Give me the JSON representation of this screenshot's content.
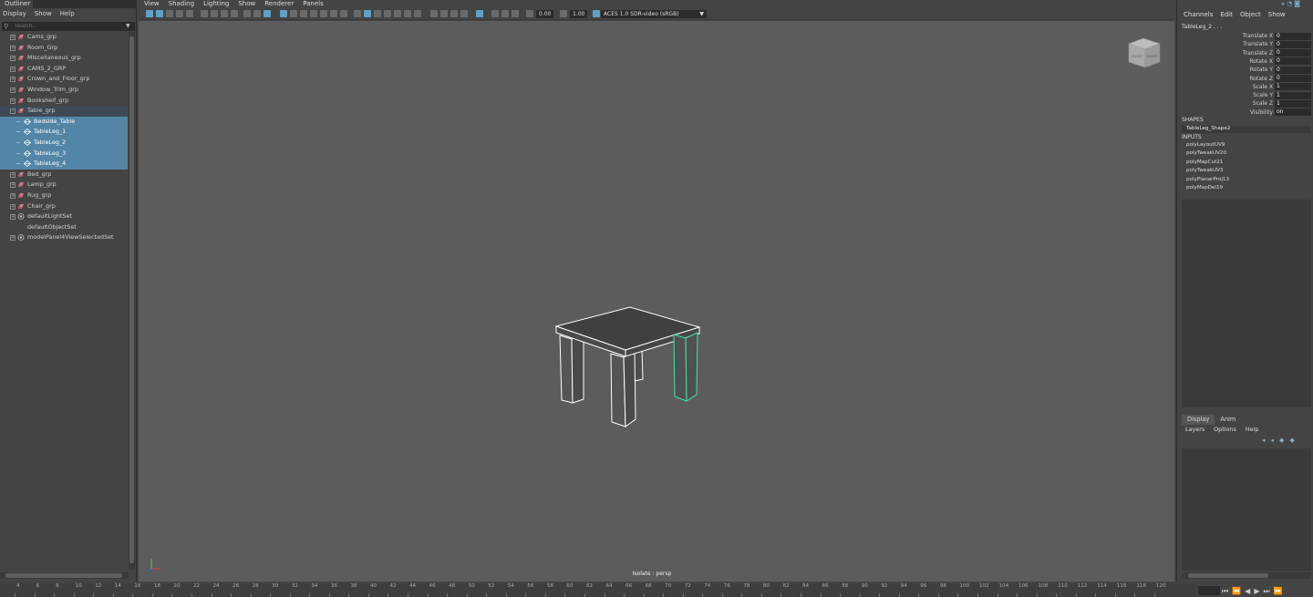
{
  "outliner": {
    "tab_label": "Outliner",
    "menu": [
      "Display",
      "Show",
      "Help"
    ],
    "search_placeholder": "Search...",
    "items": [
      {
        "label": "Cams_grp",
        "indent": 0,
        "type": "group",
        "expander": "+",
        "selected": false
      },
      {
        "label": "Room_Grp",
        "indent": 0,
        "type": "group",
        "expander": "+",
        "selected": false
      },
      {
        "label": "Miscellaneous_grp",
        "indent": 0,
        "type": "group",
        "expander": "+",
        "selected": false
      },
      {
        "label": "CAMS_2_GRP",
        "indent": 0,
        "type": "group",
        "expander": "+",
        "selected": false
      },
      {
        "label": "Crown_and_Floor_grp",
        "indent": 0,
        "type": "group",
        "expander": "+",
        "selected": false
      },
      {
        "label": "Window_Trim_grp",
        "indent": 0,
        "type": "group",
        "expander": "+",
        "selected": false
      },
      {
        "label": "Bookshelf_grp",
        "indent": 0,
        "type": "group",
        "expander": "+",
        "selected": false
      },
      {
        "label": "Table_grp",
        "indent": 0,
        "type": "group",
        "expander": "-",
        "selected": false,
        "parent_of_selection": true
      },
      {
        "label": "Bedside_Table",
        "indent": 1,
        "type": "mesh",
        "expander": "",
        "selected": true
      },
      {
        "label": "TableLeg_1",
        "indent": 1,
        "type": "mesh",
        "expander": "",
        "selected": true
      },
      {
        "label": "TableLeg_2",
        "indent": 1,
        "type": "mesh",
        "expander": "",
        "selected": true
      },
      {
        "label": "TableLeg_3",
        "indent": 1,
        "type": "mesh",
        "expander": "",
        "selected": true
      },
      {
        "label": "TableLeg_4",
        "indent": 1,
        "type": "mesh",
        "expander": "",
        "selected": true
      },
      {
        "label": "Bed_grp",
        "indent": 0,
        "type": "group",
        "expander": "+",
        "selected": false
      },
      {
        "label": "Lamp_grp",
        "indent": 0,
        "type": "group",
        "expander": "+",
        "selected": false
      },
      {
        "label": "Rug_grp",
        "indent": 0,
        "type": "group",
        "expander": "+",
        "selected": false
      },
      {
        "label": "Chair_grp",
        "indent": 0,
        "type": "group",
        "expander": "+",
        "selected": false
      },
      {
        "label": "defaultLightSet",
        "indent": 0,
        "type": "set",
        "expander": "+",
        "selected": false
      },
      {
        "label": "defaultObjectSet",
        "indent": 0,
        "type": "set-plain",
        "expander": "",
        "selected": false
      },
      {
        "label": "modelPanel4ViewSelectedSet",
        "indent": 0,
        "type": "set",
        "expander": "+",
        "selected": false
      }
    ]
  },
  "viewport": {
    "menu": [
      "View",
      "Shading",
      "Lighting",
      "Show",
      "Renderer",
      "Panels"
    ],
    "exposure": "0.00",
    "gamma": "1.00",
    "color_space": "ACES 1.0 SDR-video (sRGB)",
    "status_label": "Isolate : persp",
    "viewcube_front": "FRONT",
    "viewcube_right": "RIGHT"
  },
  "channel_box": {
    "menu": [
      "Channels",
      "Edit",
      "Object",
      "Show"
    ],
    "object_name": "TableLeg_2 . . .",
    "attributes": [
      {
        "name": "Translate X",
        "value": "0"
      },
      {
        "name": "Translate Y",
        "value": "0"
      },
      {
        "name": "Translate Z",
        "value": "0"
      },
      {
        "name": "Rotate X",
        "value": "0"
      },
      {
        "name": "Rotate Y",
        "value": "0"
      },
      {
        "name": "Rotate Z",
        "value": "0"
      },
      {
        "name": "Scale X",
        "value": "1"
      },
      {
        "name": "Scale Y",
        "value": "1"
      },
      {
        "name": "Scale Z",
        "value": "1"
      },
      {
        "name": "Visibility",
        "value": "on"
      }
    ],
    "shapes_header": "SHAPES",
    "shape_name": "TableLeg_Shape2",
    "inputs_header": "INPUTS",
    "inputs": [
      "polyLayoutUV9",
      "polyTweakUV20",
      "polyMapCut21",
      "polyTweakUV3",
      "polyPlanarProj13",
      "polyMapDel19"
    ]
  },
  "layer_editor": {
    "tabs": [
      "Display",
      "Anim"
    ],
    "menu": [
      "Layers",
      "Options",
      "Help"
    ]
  },
  "timeline": {
    "ticks": [
      "4",
      "6",
      "8",
      "10",
      "12",
      "14",
      "16",
      "18",
      "20",
      "22",
      "24",
      "26",
      "28",
      "30",
      "32",
      "34",
      "36",
      "38",
      "40",
      "42",
      "44",
      "46",
      "48",
      "50",
      "52",
      "54",
      "56",
      "58",
      "60",
      "62",
      "64",
      "66",
      "68",
      "70",
      "72",
      "74",
      "76",
      "78",
      "80",
      "82",
      "84",
      "86",
      "88",
      "90",
      "92",
      "94",
      "96",
      "98",
      "100",
      "102",
      "104",
      "106",
      "108",
      "110",
      "112",
      "114",
      "116",
      "118",
      "120"
    ],
    "playback_buttons": [
      "⏮",
      "⏪",
      "◀",
      "▶",
      "⏭",
      "⏩"
    ]
  },
  "colors": {
    "selection": "#5285a6",
    "viewport_bg": "#5c5c5c",
    "panel_bg": "#444444",
    "highlight_wire": "#3ee8a0"
  }
}
